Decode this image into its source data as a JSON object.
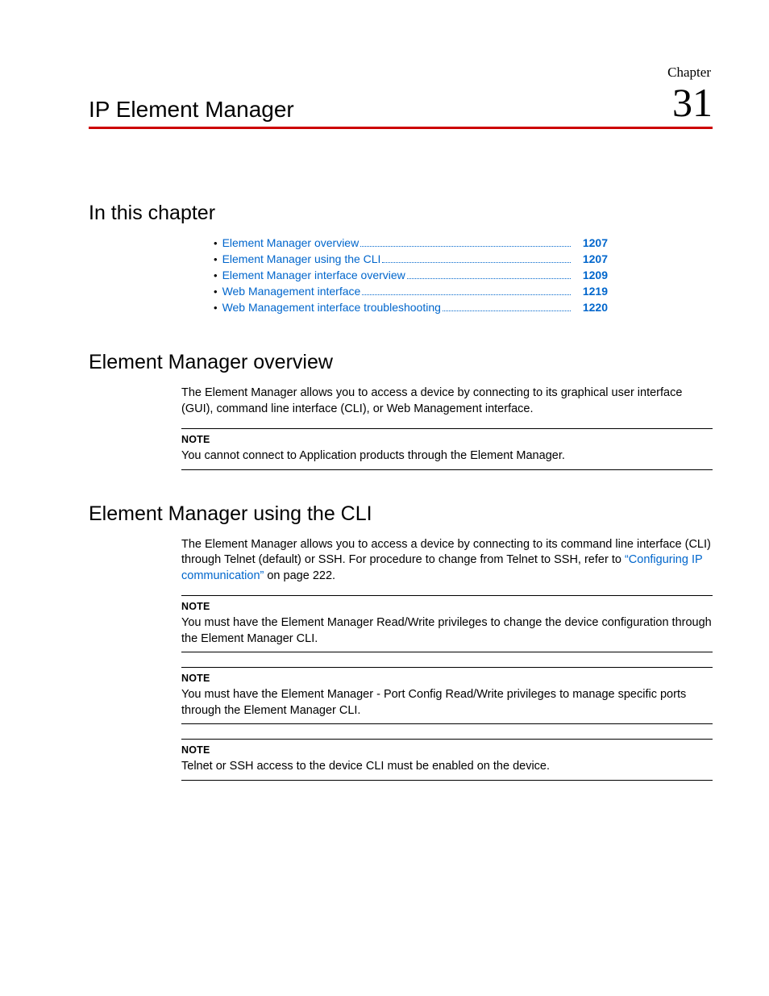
{
  "chapter_label": "Chapter",
  "chapter_number": "31",
  "chapter_title": "IP Element Manager",
  "in_this_chapter_heading": "In this chapter",
  "toc": [
    {
      "label": "Element Manager overview",
      "page": "1207"
    },
    {
      "label": "Element Manager using the CLI",
      "page": "1207"
    },
    {
      "label": "Element Manager interface overview",
      "page": "1209"
    },
    {
      "label": "Web Management interface",
      "page": "1219"
    },
    {
      "label": "Web Management interface troubleshooting",
      "page": "1220"
    }
  ],
  "overview": {
    "heading": "Element Manager overview",
    "para": "The Element Manager allows you to access a device by connecting to its graphical user interface (GUI), command line interface (CLI), or Web Management interface.",
    "note_label": "NOTE",
    "note_text": "You cannot connect to Application products through the Element Manager."
  },
  "cli": {
    "heading": "Element Manager using the CLI",
    "para_prefix": "The Element Manager allows you to access a device by connecting to its command line interface (CLI) through Telnet (default) or SSH. For procedure to change from Telnet to SSH, refer to ",
    "para_link": "“Configuring IP communication”",
    "para_suffix": " on page 222.",
    "notes": [
      {
        "label": "NOTE",
        "text": "You must have the Element Manager Read/Write privileges to change the device configuration through the Element Manager CLI."
      },
      {
        "label": "NOTE",
        "text": "You must have the Element Manager - Port Config Read/Write privileges to manage specific ports through the Element Manager CLI."
      },
      {
        "label": "NOTE",
        "text": "Telnet or SSH access to the device CLI must be enabled on the device."
      }
    ]
  }
}
